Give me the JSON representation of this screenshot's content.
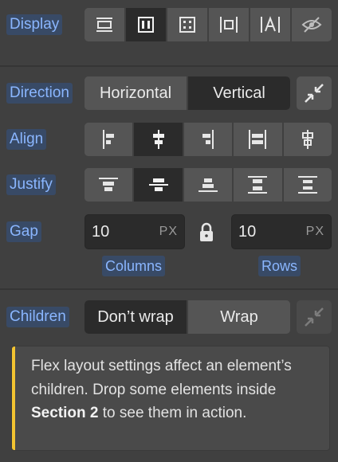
{
  "display": {
    "label": "Display",
    "options": [
      {
        "icon": "block-icon",
        "active": false
      },
      {
        "icon": "flex-icon",
        "active": true
      },
      {
        "icon": "grid-icon",
        "active": false
      },
      {
        "icon": "inline-block-icon",
        "active": false
      },
      {
        "icon": "inline-icon",
        "active": false
      },
      {
        "icon": "none-icon",
        "active": false
      }
    ]
  },
  "direction": {
    "label": "Direction",
    "options": [
      "Horizontal",
      "Vertical"
    ],
    "selected": "Vertical",
    "reverse_icon": "reverse-icon"
  },
  "align": {
    "label": "Align",
    "options": [
      "align-start-icon",
      "align-center-icon",
      "align-end-icon",
      "align-stretch-icon",
      "align-baseline-icon"
    ],
    "selected_index": 1
  },
  "justify": {
    "label": "Justify",
    "options": [
      "justify-start-icon",
      "justify-center-icon",
      "justify-end-icon",
      "justify-space-between-icon",
      "justify-space-around-icon"
    ],
    "selected_index": 1
  },
  "gap": {
    "label": "Gap",
    "columns": {
      "value": "10",
      "unit": "PX",
      "label": "Columns"
    },
    "rows": {
      "value": "10",
      "unit": "PX",
      "label": "Rows"
    },
    "lock_icon": "lock-icon"
  },
  "children": {
    "label": "Children",
    "options": [
      "Don’t wrap",
      "Wrap"
    ],
    "selected": "Don’t wrap",
    "reverse_icon": "reverse-icon"
  },
  "notice": {
    "text_before": "Flex layout settings affect an element’s children. Drop some elements inside ",
    "bold": "Section 2",
    "text_after": " to see them in action."
  },
  "colors": {
    "panel_bg": "#404040",
    "button_bg": "#555555",
    "active_bg": "#2b2b2b",
    "label_text": "#8ab6ff",
    "label_bg": "#384a66",
    "notice_accent": "#f3c431"
  }
}
